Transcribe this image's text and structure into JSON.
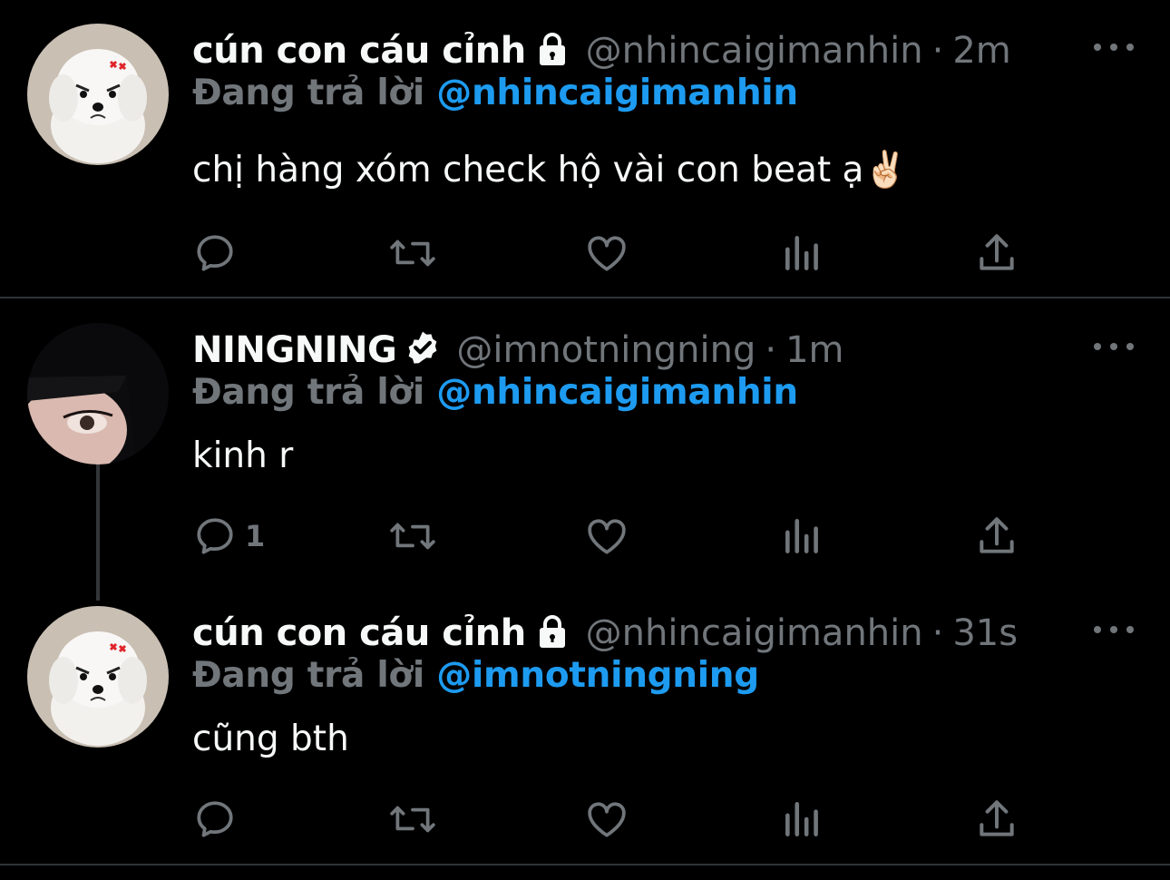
{
  "tweets": [
    {
      "name": "cún con cáu cỉnh",
      "handle": "@nhincaigimanhin",
      "separator": "·",
      "time": "2m",
      "replying_prefix": "Đang trả lời",
      "replying_to": "@nhincaigimanhin",
      "text": "chị hàng xóm check hộ vài con beat ạ✌🏻",
      "badge_icon": "lock-icon",
      "reply_count": ""
    },
    {
      "name": "NINGNING",
      "handle": "@imnotningning",
      "separator": "·",
      "time": "1m",
      "replying_prefix": "Đang trả lời",
      "replying_to": "@nhincaigimanhin",
      "text": "kinh r",
      "badge_icon": "verified-icon",
      "reply_count": "1"
    },
    {
      "name": "cún con cáu cỉnh",
      "handle": "@nhincaigimanhin",
      "separator": "·",
      "time": "31s",
      "replying_prefix": "Đang trả lời",
      "replying_to": "@imnotningning",
      "text": "cũng bth",
      "badge_icon": "lock-icon",
      "reply_count": ""
    }
  ],
  "colors": {
    "background": "#000000",
    "primary_text": "#f7f9f9",
    "secondary_text": "#71767b",
    "accent": "#1d9bf0",
    "divider": "#2f3336"
  }
}
